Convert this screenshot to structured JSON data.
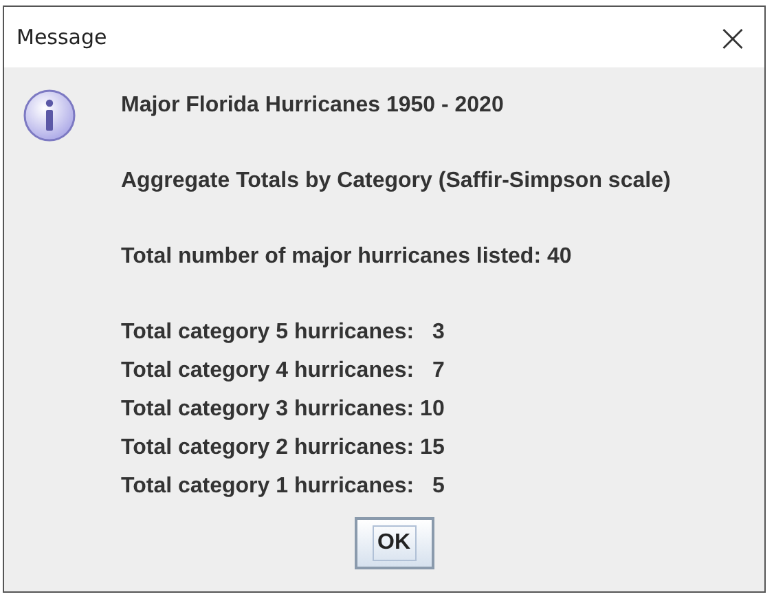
{
  "window": {
    "title": "Message",
    "close": "×"
  },
  "message": {
    "paragraphs": [
      [
        "Major Florida Hurricanes 1950 - 2020"
      ],
      [
        "Aggregate Totals by Category (Saffir-Simpson scale)"
      ],
      [
        "Total number of major hurricanes listed: 40"
      ],
      [
        "Total category 5 hurricanes:   3",
        "Total category 4 hurricanes:   7",
        "Total category 3 hurricanes: 10",
        "Total category 2 hurricanes: 15",
        "Total category 1 hurricanes:   5"
      ]
    ]
  },
  "buttons": [
    "OK"
  ]
}
